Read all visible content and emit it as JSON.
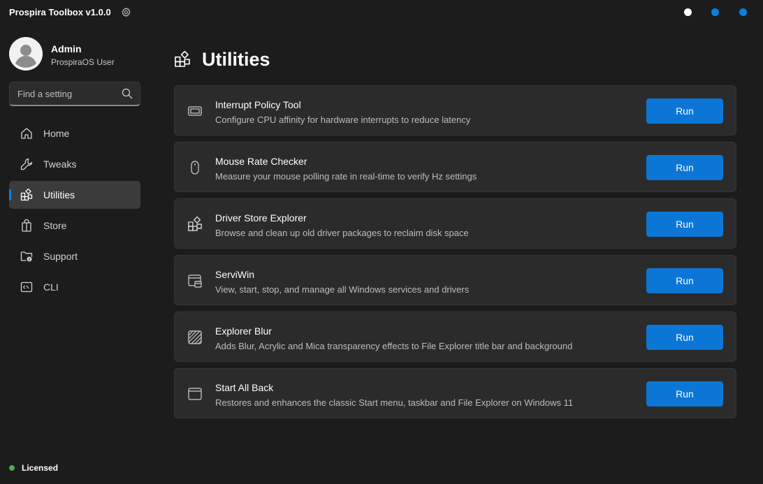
{
  "app": {
    "title": "Prospira Toolbox v1.0.0",
    "accent": "#0a7fdc"
  },
  "user": {
    "name": "Admin",
    "subtitle": "ProspiraOS User"
  },
  "search": {
    "placeholder": "Find a setting"
  },
  "nav": {
    "items": [
      {
        "label": "Home",
        "icon": "home-icon"
      },
      {
        "label": "Tweaks",
        "icon": "wrench-icon"
      },
      {
        "label": "Utilities",
        "icon": "apps-icon",
        "active": true
      },
      {
        "label": "Store",
        "icon": "shopping-bag-icon"
      },
      {
        "label": "Support",
        "icon": "folder-support-icon"
      },
      {
        "label": "CLI",
        "icon": "terminal-icon"
      }
    ]
  },
  "status": {
    "license": "Licensed",
    "license_color": "#4caf50"
  },
  "main": {
    "title": "Utilities",
    "cards": [
      {
        "title": "Interrupt Policy Tool",
        "description": "Configure CPU affinity for hardware interrupts to reduce latency",
        "icon": "cpu-chip-icon",
        "button": "Run"
      },
      {
        "title": "Mouse Rate Checker",
        "description": "Measure your mouse polling rate in real-time to verify Hz settings",
        "icon": "mouse-icon",
        "button": "Run"
      },
      {
        "title": "Driver Store Explorer",
        "description": "Browse and clean up old driver packages to reclaim disk space",
        "icon": "apps-icon",
        "button": "Run"
      },
      {
        "title": "ServiWin",
        "description": "View, start, stop, and manage all Windows services and drivers",
        "icon": "window-services-icon",
        "button": "Run"
      },
      {
        "title": "Explorer Blur",
        "description": "Adds Blur, Acrylic and Mica transparency effects to File Explorer title bar and background",
        "icon": "blur-pattern-icon",
        "button": "Run"
      },
      {
        "title": "Start All Back",
        "description": "Restores and enhances the classic Start menu, taskbar and File Explorer on Windows 11",
        "icon": "window-icon",
        "button": "Run"
      }
    ]
  }
}
